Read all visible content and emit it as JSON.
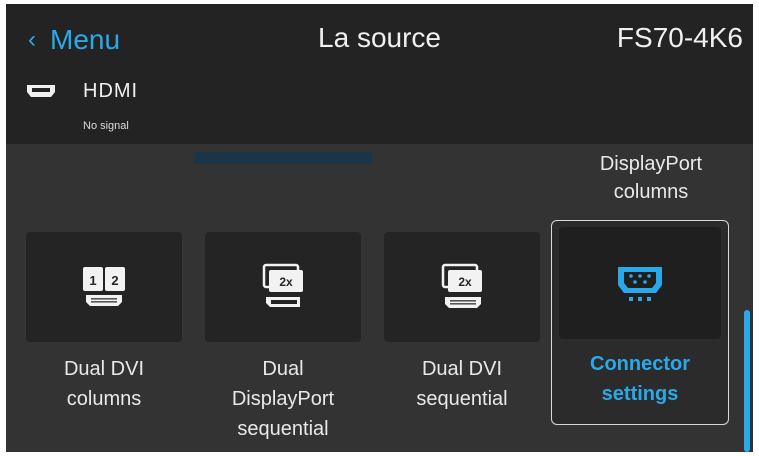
{
  "header": {
    "back_label": "Menu",
    "title": "La source",
    "device": "FS70-4K6"
  },
  "source": {
    "icon": "hdmi-port-icon",
    "name": "HDMI",
    "status": "No signal"
  },
  "previous_item": {
    "label_line1": "DisplayPort",
    "label_line2": "columns"
  },
  "tiles": [
    {
      "icon": "dual-dvi-columns-icon",
      "badge_1": "1",
      "badge_2": "2",
      "line1": "Dual DVI",
      "line2": "columns",
      "line3": ""
    },
    {
      "icon": "dual-displayport-sequential-icon",
      "badge": "2x",
      "line1": "Dual",
      "line2": "DisplayPort",
      "line3": "sequential"
    },
    {
      "icon": "dual-dvi-sequential-icon",
      "badge": "2x",
      "line1": "Dual DVI",
      "line2": "sequential",
      "line3": ""
    }
  ],
  "selected_tile": {
    "icon": "connector-settings-icon",
    "line1": "Connector",
    "line2": "settings"
  },
  "colors": {
    "accent": "#2aa9e8",
    "header_bg": "#232323",
    "screen_bg": "#333333",
    "tile_bg": "#242424"
  }
}
